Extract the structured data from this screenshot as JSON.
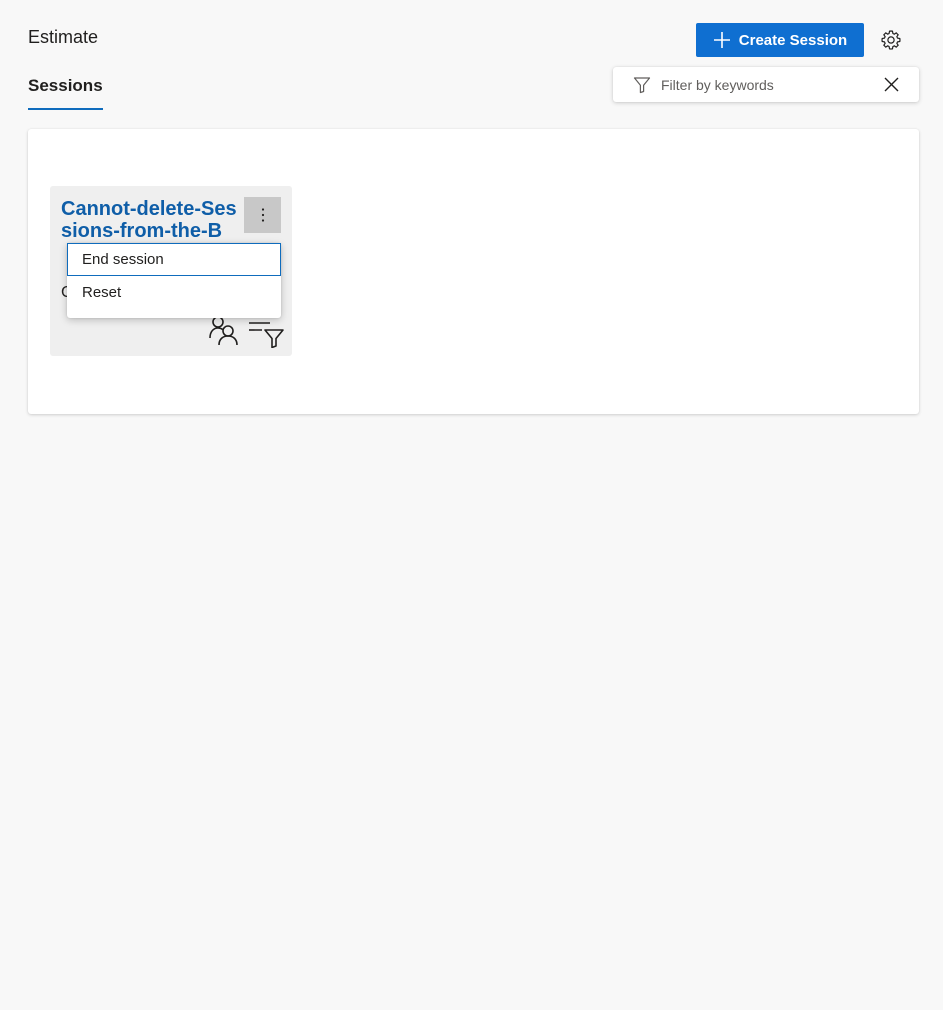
{
  "header": {
    "title": "Estimate",
    "create_label": "Create Session",
    "gear_icon": "gear-icon",
    "plus_icon": "plus-icon"
  },
  "tabs": [
    {
      "label": "Sessions",
      "selected": true
    }
  ],
  "filter": {
    "placeholder": "Filter by keywords",
    "value": "",
    "icon": "funnel-icon",
    "clear_icon": "close-icon"
  },
  "session_card": {
    "title": "Cannot-delete-Sessions-from-the-B",
    "subtitle": "C",
    "more_icon": "more-vertical-icon",
    "action_icons": [
      "people-icon",
      "filter-list-icon"
    ]
  },
  "context_menu": {
    "items": [
      {
        "label": "End session",
        "focused": true
      },
      {
        "label": "Reset",
        "focused": false
      }
    ]
  },
  "colors": {
    "accent": "#0f6fd1",
    "title_link": "#0f5ea8",
    "tab_underline": "#0f6cbd",
    "background": "#f8f8f8"
  }
}
